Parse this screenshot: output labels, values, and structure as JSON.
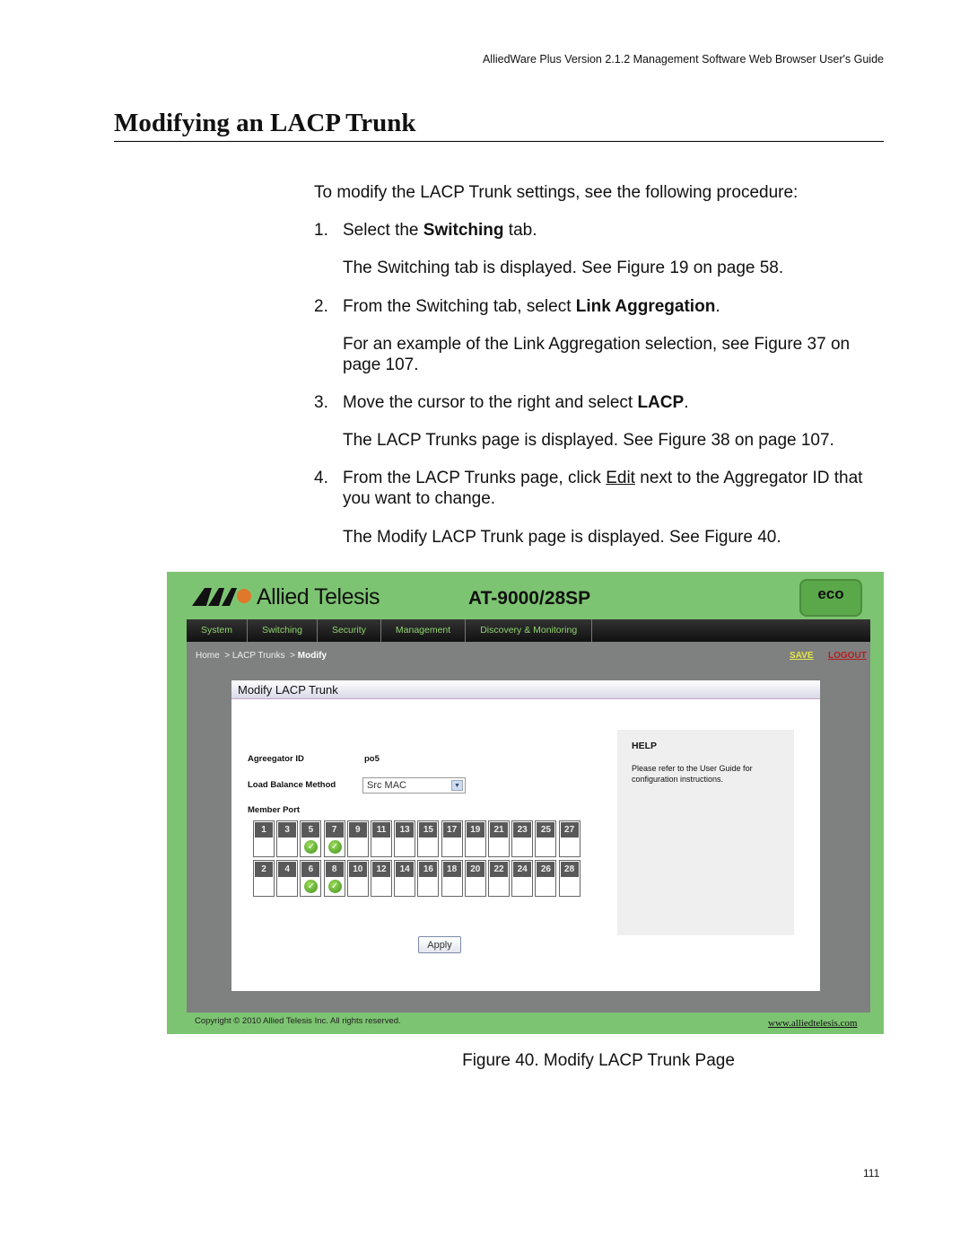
{
  "header": "AlliedWare Plus Version 2.1.2 Management Software Web Browser User's Guide",
  "title": "Modifying an LACP Trunk",
  "intro": "To modify the LACP Trunk settings, see the following procedure:",
  "steps": [
    {
      "num": "1.",
      "pre": "Select the ",
      "bold": "Switching",
      "post": " tab.",
      "note": "The Switching tab is displayed. See Figure 19 on page 58."
    },
    {
      "num": "2.",
      "pre": "From the Switching tab, select ",
      "bold": "Link Aggregation",
      "post": ".",
      "note": "For an example of the Link Aggregation selection, see Figure 37 on page 107."
    },
    {
      "num": "3.",
      "pre": "Move the cursor to the right and select ",
      "bold": "LACP",
      "post": ".",
      "note": "The LACP Trunks page is displayed. See Figure 38 on page 107."
    },
    {
      "num": "4.",
      "pre": "From the LACP Trunks page, click ",
      "link": "Edit",
      "post": " next to the Aggregator ID that you want to change.",
      "note": "The Modify LACP Trunk page is displayed. See Figure 40."
    }
  ],
  "screenshot": {
    "brand": "Allied Telesis",
    "model": "AT-9000/28SP",
    "eco": "eco",
    "tabs": [
      "System",
      "Switching",
      "Security",
      "Management",
      "Discovery & Monitoring"
    ],
    "breadcrumb": [
      "Home",
      "LACP Trunks",
      "Modify"
    ],
    "save": "SAVE",
    "logout": "LOGOUT",
    "box_title": "Modify LACP Trunk",
    "aggregator_label": "Agreegator ID",
    "aggregator_value": "po5",
    "lb_label": "Load Balance Method",
    "lb_value": "Src MAC",
    "member_label": "Member Port",
    "ports_top": [
      "1",
      "3",
      "5",
      "7",
      "9",
      "11",
      "13",
      "15",
      "17",
      "19",
      "21",
      "23",
      "25",
      "27"
    ],
    "ports_bottom": [
      "2",
      "4",
      "6",
      "8",
      "10",
      "12",
      "14",
      "16",
      "18",
      "20",
      "22",
      "24",
      "26",
      "28"
    ],
    "checked_ports": [
      "5",
      "7",
      "6",
      "8"
    ],
    "apply": "Apply",
    "help_title": "HELP",
    "help_text": "Please refer to the User Guide for configuration instructions.",
    "copyright": "Copyright © 2010 Allied Telesis Inc. All rights reserved.",
    "website": "www.alliedtelesis.com",
    "colors": {
      "frame": "#7dc472",
      "tab_text": "#8fd36f",
      "save": "#e6e64a",
      "logout": "#b32020"
    }
  },
  "caption": "Figure 40. Modify LACP Trunk Page",
  "page_number": "111"
}
